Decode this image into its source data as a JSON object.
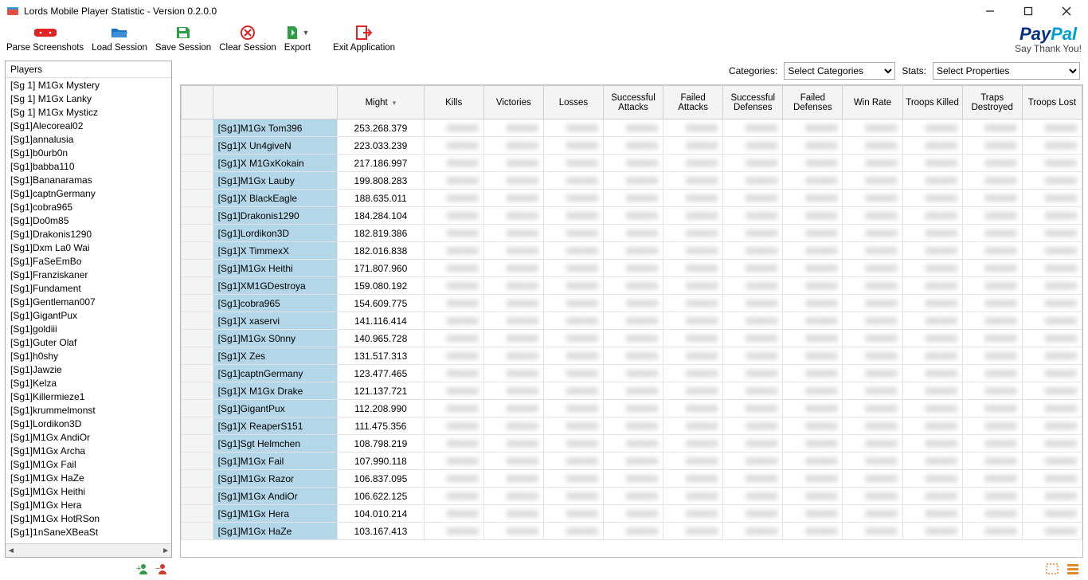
{
  "window": {
    "title": "Lords Mobile Player Statistic - Version 0.2.0.0"
  },
  "toolbar": {
    "parse": "Parse Screenshots",
    "load": "Load Session",
    "save": "Save Session",
    "clear": "Clear Session",
    "export": "Export",
    "exit": "Exit Application"
  },
  "paypal": {
    "logo1": "Pay",
    "logo2": "Pal",
    "sub": "Say Thank You!"
  },
  "filters": {
    "categories_label": "Categories:",
    "categories_value": "Select Categories",
    "stats_label": "Stats:",
    "stats_value": "Select Properties"
  },
  "sidebar": {
    "header": "Players",
    "items": [
      "[Sg 1] M1Gx Mystery",
      "[Sg 1] M1Gx Lanky",
      "[Sg 1] M1Gx Mysticz",
      "[Sg1]Alecoreal02",
      "[Sg1]annalusia",
      "[Sg1]b0urb0n",
      "[Sg1]babba110",
      "[Sg1]Bananaramas",
      "[Sg1]captnGermany",
      "[Sg1]cobra965",
      "[Sg1]Do0m85",
      "[Sg1]Drakonis1290",
      "[Sg1]Dxm La0 Wai",
      "[Sg1]FaSeEmBo",
      "[Sg1]Franziskaner",
      "[Sg1]Fundament",
      "[Sg1]Gentleman007",
      "[Sg1]GigantPux",
      "[Sg1]goldiii",
      "[Sg1]Guter Olaf",
      "[Sg1]h0shy",
      "[Sg1]Jawzie",
      "[Sg1]Kelza",
      "[Sg1]Killermieze1",
      "[Sg1]krummelmonst",
      "[Sg1]Lordikon3D",
      "[Sg1]M1Gx AndiOr",
      "[Sg1]M1Gx Archa",
      "[Sg1]M1Gx Fail",
      "[Sg1]M1Gx HaZe",
      "[Sg1]M1Gx Heithi",
      "[Sg1]M1Gx Hera",
      "[Sg1]M1Gx HotRSon",
      "[Sg1]1nSaneXBeaSt"
    ]
  },
  "grid": {
    "headers": [
      "",
      "",
      "Might",
      "Kills",
      "Victories",
      "Losses",
      "Successful Attacks",
      "Failed Attacks",
      "Successful Defenses",
      "Failed Defenses",
      "Win Rate",
      "Troops Killed",
      "Traps Destroyed",
      "Troops Lost"
    ],
    "rows": [
      {
        "name": "[Sg1]M1Gx Tom396",
        "might": "253.268.379"
      },
      {
        "name": "[Sg1]X Un4giveN",
        "might": "223.033.239"
      },
      {
        "name": "[Sg1]X M1GxKokain",
        "might": "217.186.997"
      },
      {
        "name": "[Sg1]M1Gx Lauby",
        "might": "199.808.283"
      },
      {
        "name": "[Sg1]X BlackEagle",
        "might": "188.635.011"
      },
      {
        "name": "[Sg1]Drakonis1290",
        "might": "184.284.104"
      },
      {
        "name": "[Sg1]Lordikon3D",
        "might": "182.819.386"
      },
      {
        "name": "[Sg1]X TimmexX",
        "might": "182.016.838"
      },
      {
        "name": "[Sg1]M1Gx Heithi",
        "might": "171.807.960"
      },
      {
        "name": "[Sg1]XM1GDestroya",
        "might": "159.080.192"
      },
      {
        "name": "[Sg1]cobra965",
        "might": "154.609.775"
      },
      {
        "name": "[Sg1]X xaservi",
        "might": "141.116.414"
      },
      {
        "name": "[Sg1]M1Gx S0nny",
        "might": "140.965.728"
      },
      {
        "name": "[Sg1]X Zes",
        "might": "131.517.313"
      },
      {
        "name": "[Sg1]captnGermany",
        "might": "123.477.465"
      },
      {
        "name": "[Sg1]X M1Gx Drake",
        "might": "121.137.721"
      },
      {
        "name": "[Sg1]GigantPux",
        "might": "112.208.990"
      },
      {
        "name": "[Sg1]X ReaperS151",
        "might": "111.475.356"
      },
      {
        "name": "[Sg1]Sgt Helmchen",
        "might": "108.798.219"
      },
      {
        "name": "[Sg1]M1Gx Fail",
        "might": "107.990.118"
      },
      {
        "name": "[Sg1]M1Gx Razor",
        "might": "106.837.095"
      },
      {
        "name": "[Sg1]M1Gx AndiOr",
        "might": "106.622.125"
      },
      {
        "name": "[Sg1]M1Gx Hera",
        "might": "104.010.214"
      },
      {
        "name": "[Sg1]M1Gx HaZe",
        "might": "103.167.413"
      }
    ]
  }
}
